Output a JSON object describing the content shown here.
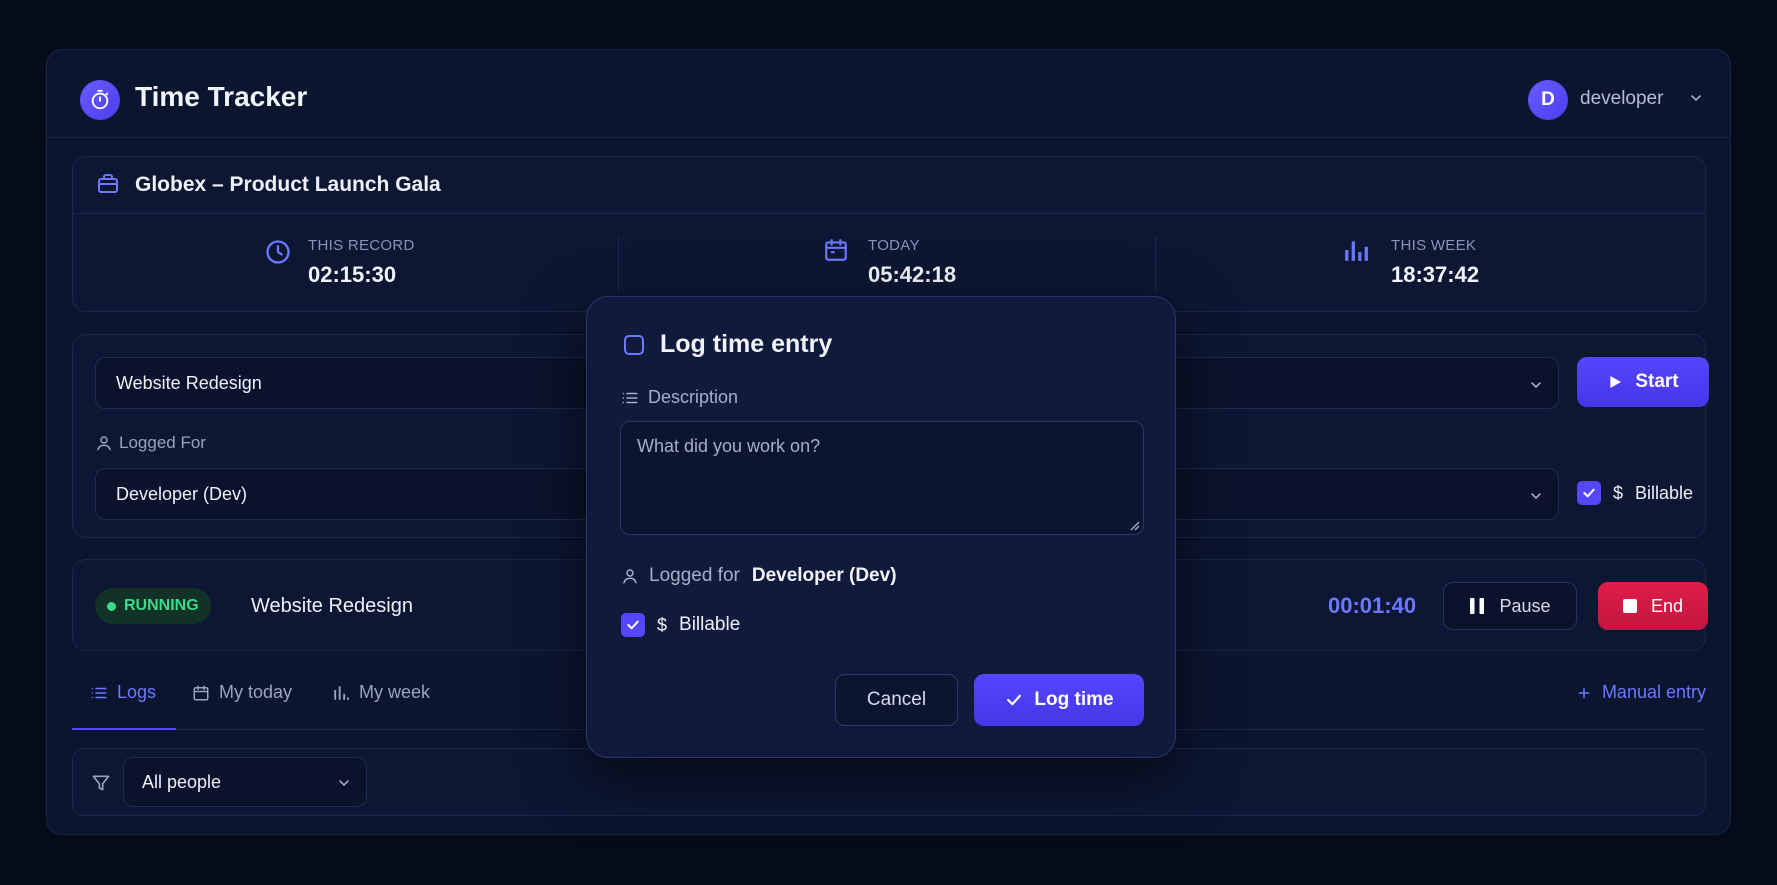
{
  "app": {
    "title": "Time Tracker"
  },
  "user": {
    "initial": "D",
    "name": "developer"
  },
  "project": {
    "name": "Globex – Product Launch Gala"
  },
  "stats": [
    {
      "label": "THIS RECORD",
      "value": "02:15:30",
      "icon": "clock-icon"
    },
    {
      "label": "TODAY",
      "value": "05:42:18",
      "icon": "calendar-icon"
    },
    {
      "label": "THIS WEEK",
      "value": "18:37:42",
      "icon": "bar-chart-icon"
    }
  ],
  "form": {
    "task_value": "Website Redesign",
    "logged_for_label": "Logged For",
    "logged_for_value": "Developer (Dev)",
    "start_label": "Start",
    "billable_label": "Billable",
    "billable_checked": true
  },
  "running": {
    "status": "RUNNING",
    "task": "Website Redesign",
    "timer": "00:01:40",
    "pause_label": "Pause",
    "end_label": "End"
  },
  "tabs": [
    {
      "label": "Logs",
      "active": true
    },
    {
      "label": "My today",
      "active": false
    },
    {
      "label": "My week",
      "active": false
    }
  ],
  "manual_entry_label": "Manual entry",
  "filter": {
    "value": "All people"
  },
  "modal": {
    "title": "Log time entry",
    "description_label": "Description",
    "description_placeholder": "What did you work on?",
    "logged_for_label": "Logged for",
    "logged_for_value": "Developer (Dev)",
    "billable_label": "Billable",
    "billable_checked": true,
    "cancel_label": "Cancel",
    "submit_label": "Log time"
  },
  "colors": {
    "accent": "#5546ff",
    "accent_text": "#6b78ff",
    "running_green": "#3fd98a",
    "danger": "#e11d48",
    "background": "#060b1a",
    "panel": "#0c1530"
  }
}
